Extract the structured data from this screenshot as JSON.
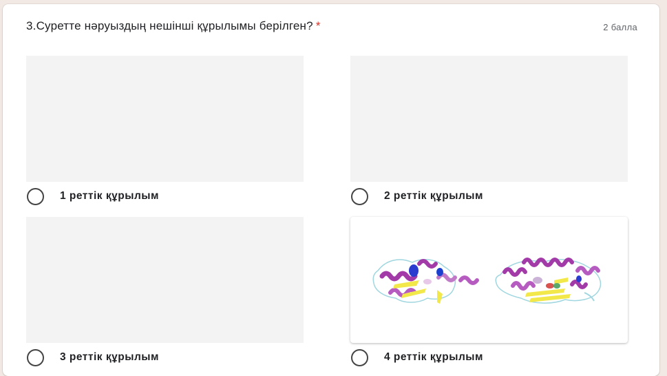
{
  "question": {
    "title": "3.Суретте нәруыздың нешінші құрылымы берілген?",
    "required_mark": "*",
    "points": "2 балла"
  },
  "options": [
    {
      "label": "1 реттік құрылым",
      "has_image": false
    },
    {
      "label": "2 реттік құрылым",
      "has_image": false
    },
    {
      "label": "3 реттік құрылым",
      "has_image": false
    },
    {
      "label": "4 реттік құрылым",
      "has_image": true,
      "image": "protein-quaternary-structure-illustration"
    }
  ],
  "colors": {
    "required": "#d93025",
    "helix": "#a23aa8",
    "sheet": "#f2e84a",
    "coil": "#9fd6df"
  }
}
